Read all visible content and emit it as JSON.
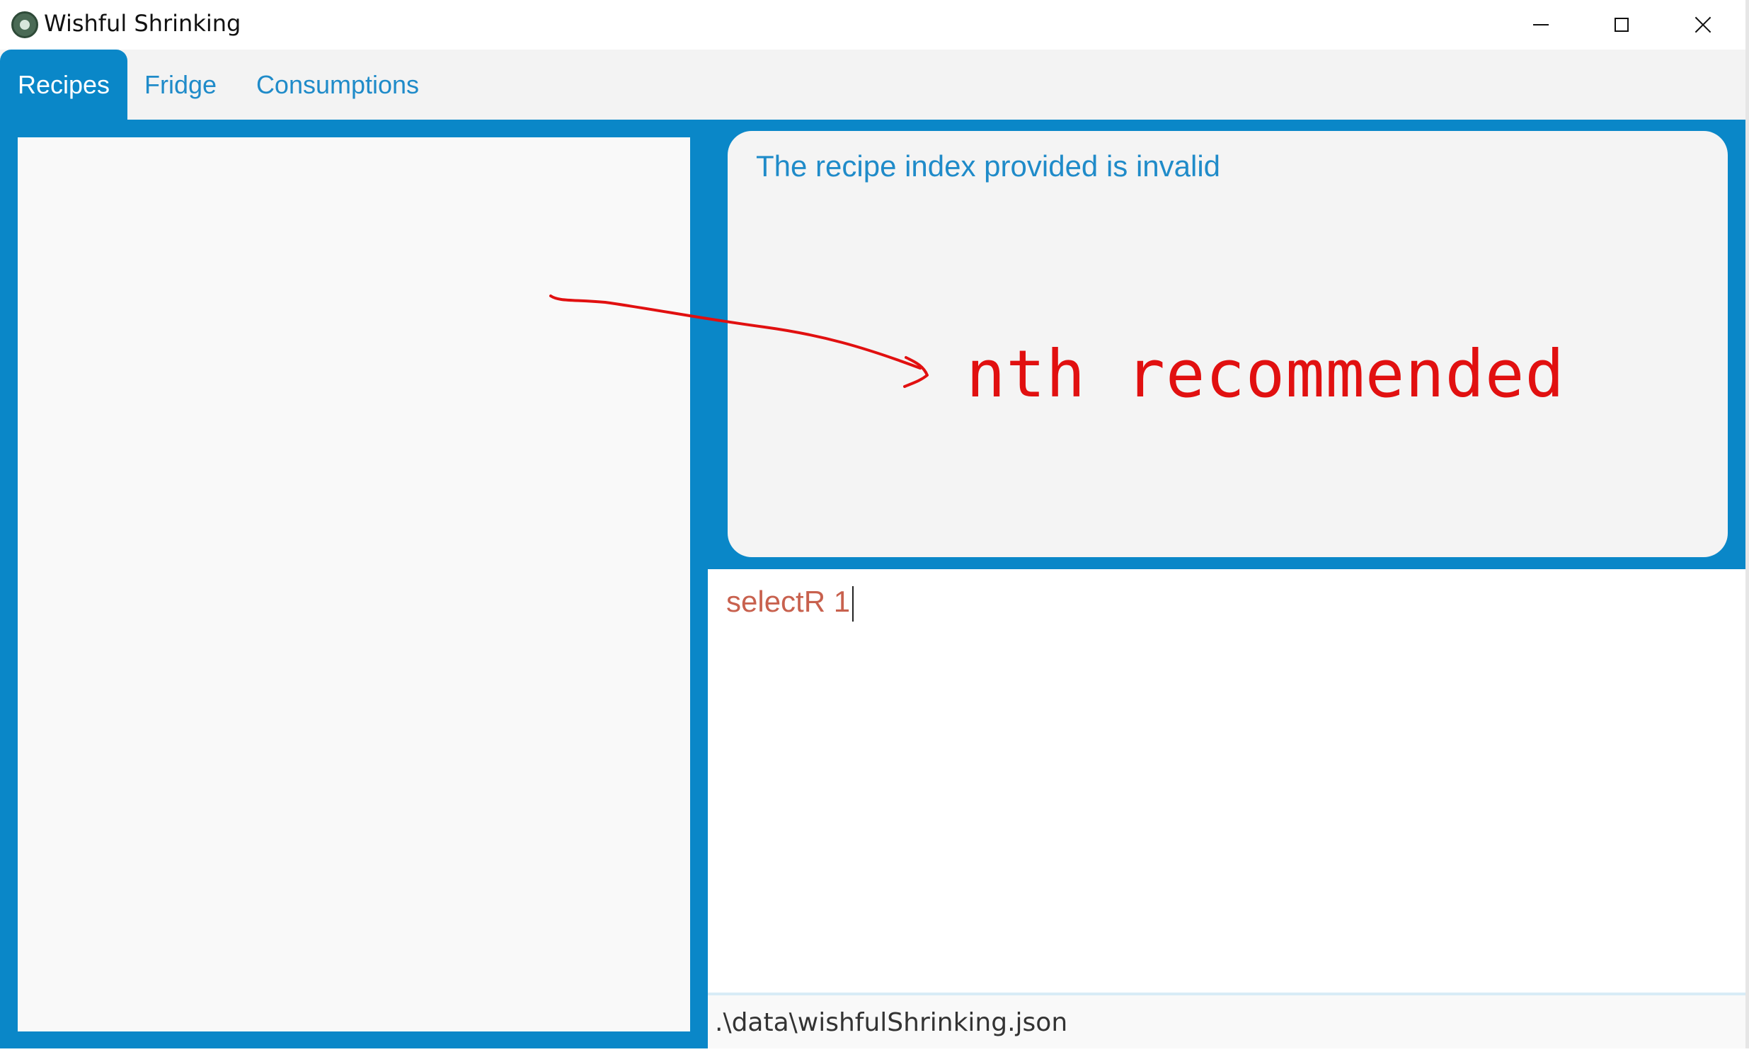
{
  "window": {
    "title": "Wishful Shrinking",
    "icon": "app-logo-icon",
    "controls": [
      "minimize-icon",
      "maximize-icon",
      "close-icon"
    ]
  },
  "tabs": [
    {
      "label": "Recipes",
      "selected": true
    },
    {
      "label": "Fridge",
      "selected": false
    },
    {
      "label": "Consumptions",
      "selected": false
    }
  ],
  "result_display": {
    "message": "The recipe index provided is invalid"
  },
  "command_box": {
    "value": "selectR 1"
  },
  "status_bar": {
    "path": ".\\data\\wishfulShrinking.json"
  },
  "annotation": {
    "text": "nth recommended",
    "color": "#e11010"
  },
  "colors": {
    "accent": "#0a87c8",
    "tab_text": "#1f8bc9",
    "command_text": "#c8614e",
    "panel": "#f4f4f4"
  }
}
